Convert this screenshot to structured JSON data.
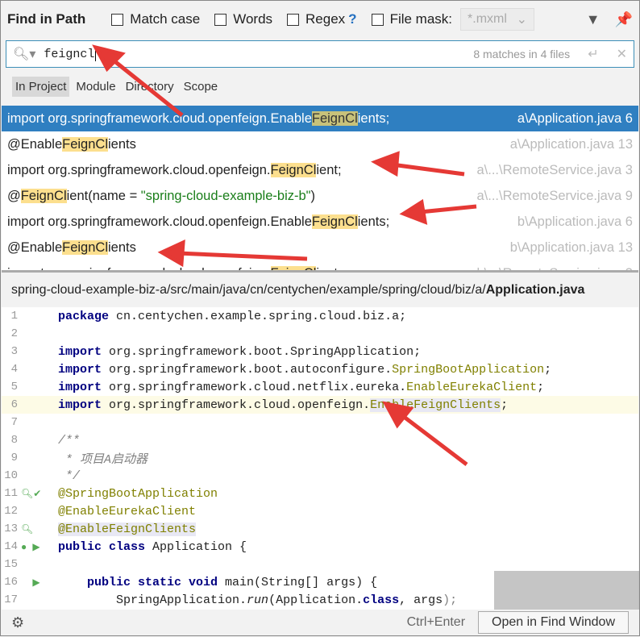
{
  "header": {
    "title": "Find in Path",
    "match_case": "Match case",
    "words": "Words",
    "regex": "Regex",
    "regex_help": "?",
    "file_mask": "File mask:",
    "file_mask_value": "*.mxml"
  },
  "search": {
    "value": "feigncl",
    "count": "8 matches in 4 files"
  },
  "scopes": [
    "In Project",
    "Module",
    "Directory",
    "Scope"
  ],
  "results": [
    {
      "pre": "import org.springframework.cloud.openfeign.Enable",
      "match": "FeignCl",
      "post": "ients;",
      "file": "a\\Application.java 6",
      "selected": true
    },
    {
      "pre": "@Enable",
      "match": "FeignCl",
      "post": "ients",
      "file": "a\\Application.java 13"
    },
    {
      "pre": "import org.springframework.cloud.openfeign.",
      "match": "FeignCl",
      "post": "ient;",
      "file": "a\\...\\RemoteService.java 3"
    },
    {
      "pre": "@",
      "match": "FeignCl",
      "post": "ient(name = ",
      "str": "\"spring-cloud-example-biz-b\"",
      "post2": ")",
      "file": "a\\...\\RemoteService.java 9"
    },
    {
      "pre": "import org.springframework.cloud.openfeign.Enable",
      "match": "FeignCl",
      "post": "ients;",
      "file": "b\\Application.java 6"
    },
    {
      "pre": "@Enable",
      "match": "FeignCl",
      "post": "ients",
      "file": "b\\Application.java 13"
    },
    {
      "pre": "import org.springframework.cloud.openfeign.",
      "match": "FeignCl",
      "post": "ient;",
      "file": "b\\...\\RemoteService.java 3"
    }
  ],
  "preview": {
    "path": "spring-cloud-example-biz-a/src/main/java/cn/centychen/example/spring/cloud/biz/a/",
    "file": "Application.java"
  },
  "code": [
    [
      [
        "package",
        "kw"
      ],
      [
        " cn.centychen.example.spring.cloud.biz.a;",
        ""
      ]
    ],
    [],
    [
      [
        "import",
        "kw"
      ],
      [
        " org.springframework.boot.SpringApplication;",
        ""
      ]
    ],
    [
      [
        "import",
        "kw"
      ],
      [
        " org.springframework.boot.autoconfigure.",
        ""
      ],
      [
        "SpringBootApplication",
        "an"
      ],
      [
        ";",
        ""
      ]
    ],
    [
      [
        "import",
        "kw"
      ],
      [
        " org.springframework.cloud.netflix.eureka.",
        ""
      ],
      [
        "EnableEurekaClient",
        "an"
      ],
      [
        ";",
        ""
      ]
    ],
    [
      [
        "import",
        "kw"
      ],
      [
        " org.springframework.cloud.openfeign.",
        ""
      ],
      [
        "EnableFeignClients",
        "an hlu"
      ],
      [
        ";",
        ""
      ]
    ],
    [],
    [
      [
        "/**",
        "cm"
      ]
    ],
    [
      [
        " * 项目A启动器",
        "cm"
      ]
    ],
    [
      [
        " */",
        "cm"
      ]
    ],
    [
      [
        "@SpringBootApplication",
        "an"
      ]
    ],
    [
      [
        "@EnableEurekaClient",
        "an"
      ]
    ],
    [
      [
        "@EnableFeignClients",
        "an hlu"
      ]
    ],
    [
      [
        "public class",
        "kw"
      ],
      [
        " Application {",
        ""
      ]
    ],
    [],
    [
      [
        "    public static void",
        "kw"
      ],
      [
        " main(String[] args) {",
        ""
      ]
    ],
    [
      [
        "        SpringApplication.",
        ""
      ],
      [
        "run",
        "it"
      ],
      [
        "(Application.",
        ""
      ],
      [
        "class",
        "kw"
      ],
      [
        ", args",
        ""
      ],
      [
        ");",
        "gr"
      ]
    ]
  ],
  "footer": {
    "shortcut": "Ctrl+Enter",
    "open_button": "Open in Find Window"
  }
}
